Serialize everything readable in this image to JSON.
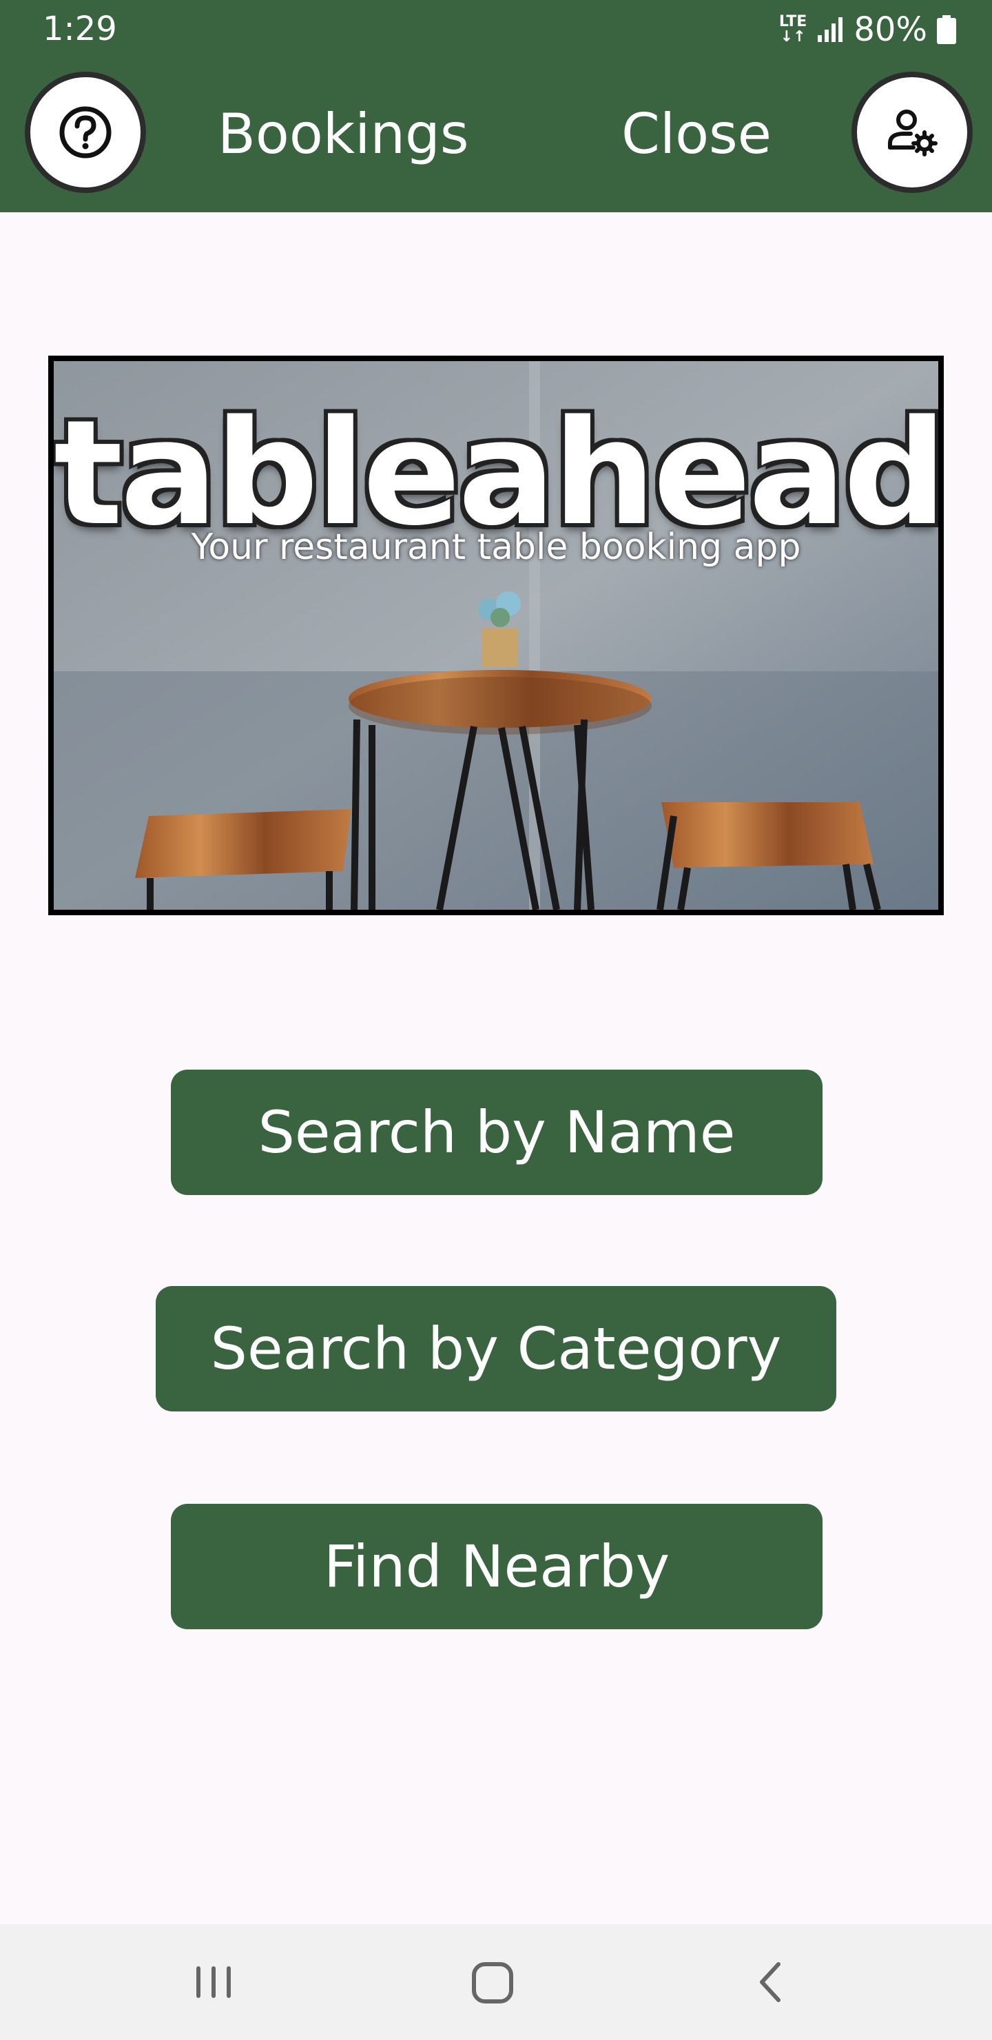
{
  "status_bar": {
    "time": "1:29",
    "network": "LTE",
    "battery": "80%"
  },
  "header": {
    "bookings_label": "Bookings",
    "close_label": "Close"
  },
  "banner": {
    "title": "tableahead",
    "subtitle": "Your restaurant table booking app"
  },
  "actions": {
    "search_by_name": "Search by Name",
    "search_by_category": "Search by Category",
    "find_nearby": "Find Nearby"
  },
  "colors": {
    "primary": "#3a6440",
    "background": "#fdf8fb",
    "nav_bar": "#f1f1f1"
  },
  "icons": {
    "help": "help-circle-icon",
    "account": "user-settings-icon",
    "recents": "recents-icon",
    "home": "home-icon",
    "back": "back-icon"
  }
}
